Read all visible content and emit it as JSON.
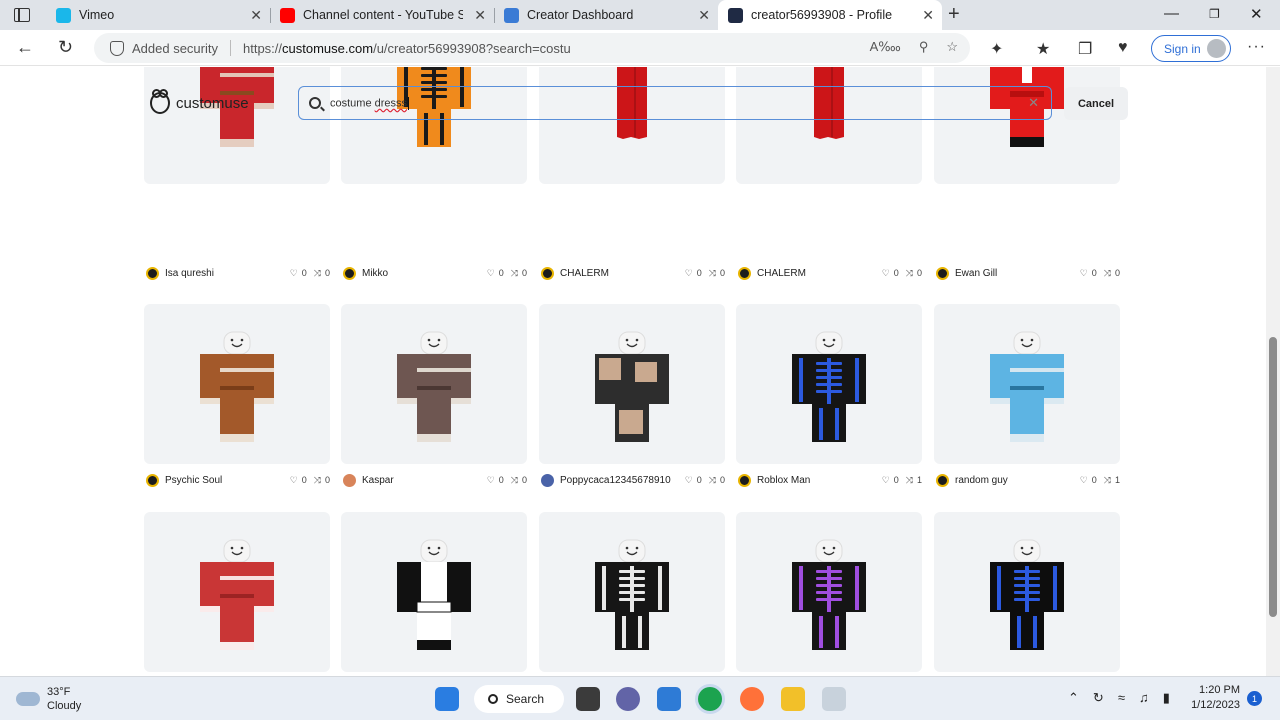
{
  "browser": {
    "tabs": [
      {
        "title": "Vimeo",
        "icon": "vimeo-icon",
        "color": "#1ab7ea"
      },
      {
        "title": "Channel content - YouTube Studio",
        "icon": "youtube-icon",
        "color": "#ff0000"
      },
      {
        "title": "Creator Dashboard",
        "icon": "roblox-icon",
        "color": "#3a7bd5"
      },
      {
        "title": "creator56993908 - Profile",
        "icon": "customuse-icon",
        "color": "#1f2a44",
        "active": true
      }
    ],
    "security_label": "Added security",
    "url_prefix": "https://",
    "url_host": "customuse.com",
    "url_path": "/u/creator56993908?search=costu",
    "sign_in_label": "Sign in"
  },
  "page": {
    "brand": "customuse",
    "search": {
      "value_plain": "costume ",
      "value_misspelled": "dresss"
    },
    "cancel_label": "Cancel",
    "rows": [
      [
        {
          "creator": "Isa qureshi",
          "likes": "0",
          "remixes": "0",
          "outfit": "christmas-sweater",
          "colors": [
            "#c9262c",
            "#e8e0d0",
            "#8a4a1f"
          ]
        },
        {
          "creator": "Mikko",
          "likes": "0",
          "remixes": "0",
          "outfit": "orange-skeleton",
          "colors": [
            "#f08a1c",
            "#1a1a1a",
            "#ffffff"
          ]
        },
        {
          "creator": "CHALERM",
          "likes": "0",
          "remixes": "0",
          "outfit": "red-dress",
          "colors": [
            "#cc1518"
          ]
        },
        {
          "creator": "CHALERM",
          "likes": "0",
          "remixes": "0",
          "outfit": "red-dress",
          "colors": [
            "#cc1518"
          ]
        },
        {
          "creator": "Ewan Gill",
          "likes": "0",
          "remixes": "0",
          "outfit": "red-suit",
          "colors": [
            "#e21b1b",
            "#ffffff",
            "#111111"
          ]
        }
      ],
      [
        {
          "creator": "Psychic Soul",
          "likes": "0",
          "remixes": "0",
          "outfit": "brown-robe",
          "colors": [
            "#a3592a",
            "#f3eee5",
            "#7a3d18"
          ]
        },
        {
          "creator": "Kaspar",
          "likes": "0",
          "remixes": "0",
          "outfit": "grey-robe",
          "colors": [
            "#6e5651",
            "#f3eee5",
            "#4b3733"
          ],
          "avatar_color": "#d8845a"
        },
        {
          "creator": "Poppycaca12345678910",
          "likes": "0",
          "remixes": "0",
          "outfit": "photo-print",
          "colors": [
            "#2d2d2d",
            "#c9a98f",
            "#f5f5f5"
          ],
          "avatar_color": "#4a63a8"
        },
        {
          "creator": "Roblox Man",
          "likes": "0",
          "remixes": "1",
          "outfit": "blue-skeleton",
          "colors": [
            "#151515",
            "#2c5ae0"
          ]
        },
        {
          "creator": "random guy",
          "likes": "0",
          "remixes": "1",
          "outfit": "blue-camo",
          "colors": [
            "#5db4e3",
            "#e9eef2",
            "#29759f"
          ]
        }
      ],
      [
        {
          "outfit": "red-knit",
          "colors": [
            "#c93636",
            "#ffffff",
            "#9c2323"
          ]
        },
        {
          "outfit": "maid",
          "colors": [
            "#111111",
            "#ffffff"
          ]
        },
        {
          "outfit": "white-skeleton",
          "colors": [
            "#161616",
            "#e8e8e8"
          ]
        },
        {
          "outfit": "purple-skeleton",
          "colors": [
            "#151515",
            "#a04ee0"
          ]
        },
        {
          "outfit": "blue-skeleton",
          "colors": [
            "#0d0d0d",
            "#2c5ae0"
          ]
        }
      ]
    ]
  },
  "taskbar": {
    "weather_temp": "33°F",
    "weather_desc": "Cloudy",
    "search_label": "Search",
    "time": "1:20 PM",
    "date": "1/12/2023",
    "notifications": "1"
  }
}
